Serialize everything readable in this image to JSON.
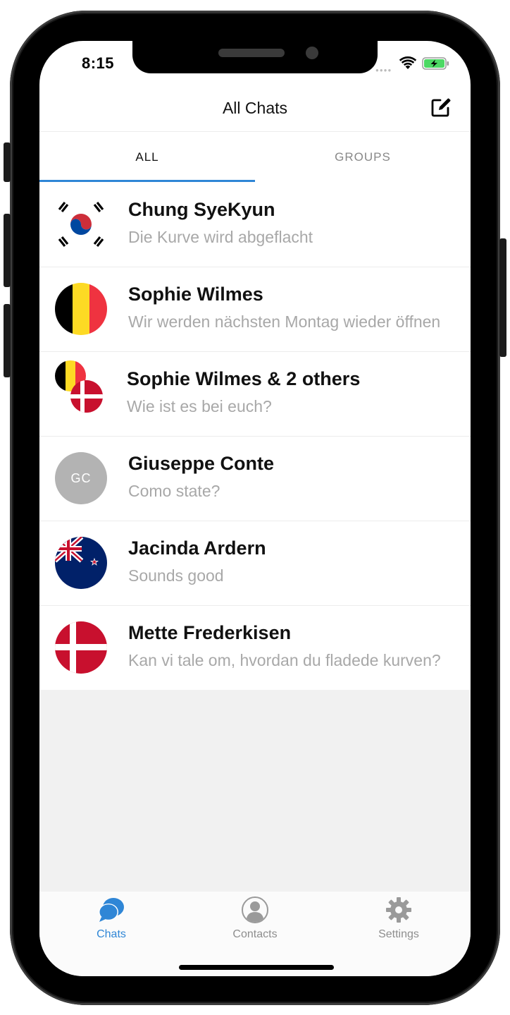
{
  "status_bar": {
    "time": "8:15"
  },
  "header": {
    "title": "All Chats"
  },
  "tabs": [
    {
      "label": "ALL",
      "active": true
    },
    {
      "label": "GROUPS",
      "active": false
    }
  ],
  "chats": [
    {
      "name": "Chung SyeKyun",
      "message": "Die Kurve wird abgeflacht",
      "avatar": "south-korea-flag"
    },
    {
      "name": "Sophie Wilmes",
      "message": "Wir werden nächsten Montag wieder öffnen",
      "avatar": "belgium-flag"
    },
    {
      "name": "Sophie Wilmes & 2 others",
      "message": "Wie ist es bei euch?",
      "avatar": "group-flags"
    },
    {
      "name": "Giuseppe Conte",
      "message": "Como state?",
      "avatar": "initials",
      "initials": "GC"
    },
    {
      "name": "Jacinda Ardern",
      "message": "Sounds good",
      "avatar": "new-zealand-flag"
    },
    {
      "name": "Mette Frederkisen",
      "message": "Kan vi tale om, hvordan du fladede kurven?",
      "avatar": "denmark-flag"
    }
  ],
  "tabbar": [
    {
      "label": "Chats",
      "icon": "chat-bubbles-icon",
      "active": true
    },
    {
      "label": "Contacts",
      "icon": "person-icon",
      "active": false
    },
    {
      "label": "Settings",
      "icon": "gear-icon",
      "active": false
    }
  ],
  "colors": {
    "accent": "#2f86d6",
    "inactive": "#8e8e8e",
    "message_text": "#a8a8a8",
    "empty_background": "#f1f1f1"
  }
}
